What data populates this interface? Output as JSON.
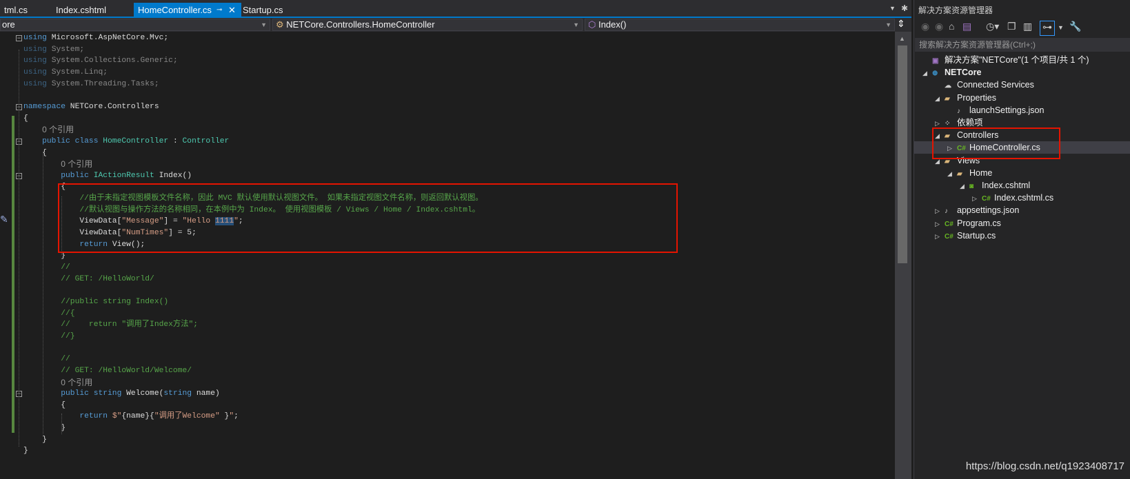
{
  "tabs": [
    {
      "label": "tml.cs",
      "active": false
    },
    {
      "label": "Index.cshtml",
      "active": false
    },
    {
      "label": "HomeController.cs",
      "active": true
    },
    {
      "label": "Startup.cs",
      "active": false
    }
  ],
  "tab_pin_icon": "pin-icon",
  "tab_close_icon": "close-icon",
  "nav": {
    "project": "ore",
    "type": "NETCore.Controllers.HomeController",
    "member": "Index()"
  },
  "code": [
    [
      [
        "using ",
        "kw"
      ],
      [
        "Microsoft.AspNetCore.Mvc;",
        "pl"
      ]
    ],
    [
      [
        "using ",
        "kw dim"
      ],
      [
        "System;",
        "pl dim"
      ]
    ],
    [
      [
        "using ",
        "kw dim"
      ],
      [
        "System.Collections.Generic;",
        "pl dim"
      ]
    ],
    [
      [
        "using ",
        "kw dim"
      ],
      [
        "System.Linq;",
        "pl dim"
      ]
    ],
    [
      [
        "using ",
        "kw dim"
      ],
      [
        "System.Threading.Tasks;",
        "pl dim"
      ]
    ],
    [],
    [
      [
        "namespace ",
        "kw"
      ],
      [
        "NETCore.Controllers",
        "pl"
      ]
    ],
    [
      [
        "{",
        "pl"
      ]
    ],
    [
      [
        "    ",
        "pl"
      ],
      [
        "0 个引用",
        "lens"
      ]
    ],
    [
      [
        "    public class ",
        "kw"
      ],
      [
        "HomeController",
        "ty"
      ],
      [
        " : ",
        "pl"
      ],
      [
        "Controller",
        "ty"
      ]
    ],
    [
      [
        "    {",
        "pl"
      ]
    ],
    [
      [
        "        ",
        "pl"
      ],
      [
        "0 个引用",
        "lens"
      ]
    ],
    [
      [
        "        public ",
        "kw"
      ],
      [
        "IActionResult ",
        "ty"
      ],
      [
        "Index()",
        "pl"
      ]
    ],
    [
      [
        "        {",
        "pl"
      ]
    ],
    [
      [
        "            //由于未指定视图模板文件名称，因此 MVC 默认使用默认视图文件。 如果未指定视图文件名称，则返回默认视图。",
        "cm"
      ]
    ],
    [
      [
        "            //默认视图与操作方法的名称相同，在本例中为 Index。 使用视图模板 / Views / Home / Index.cshtml。",
        "cm"
      ]
    ],
    [
      [
        "            ViewData[",
        "pl"
      ],
      [
        "\"Message\"",
        "st"
      ],
      [
        "] = ",
        "pl"
      ],
      [
        "\"Hello ",
        "st"
      ],
      [
        "1111",
        "st sel"
      ],
      [
        "\"",
        "st"
      ],
      [
        ";",
        "pl"
      ]
    ],
    [
      [
        "            ViewData[",
        "pl"
      ],
      [
        "\"NumTimes\"",
        "st"
      ],
      [
        "] = 5;",
        "pl"
      ]
    ],
    [
      [
        "            return ",
        "kw"
      ],
      [
        "View();",
        "pl"
      ]
    ],
    [
      [
        "        }",
        "pl"
      ]
    ],
    [
      [
        "        //",
        "cm"
      ]
    ],
    [
      [
        "        // GET: /HelloWorld/",
        "cm"
      ]
    ],
    [],
    [
      [
        "        //public string Index()",
        "cm"
      ]
    ],
    [
      [
        "        //{",
        "cm"
      ]
    ],
    [
      [
        "        //    return \"调用了Index方法\";",
        "cm"
      ]
    ],
    [
      [
        "        //}",
        "cm"
      ]
    ],
    [],
    [
      [
        "        //",
        "cm"
      ]
    ],
    [
      [
        "        // GET: /HelloWorld/Welcome/",
        "cm"
      ]
    ],
    [
      [
        "        ",
        "pl"
      ],
      [
        "0 个引用",
        "lens"
      ]
    ],
    [
      [
        "        public string ",
        "kw"
      ],
      [
        "Welcome(",
        "pl"
      ],
      [
        "string ",
        "kw"
      ],
      [
        "name)",
        "pl"
      ]
    ],
    [
      [
        "        {",
        "pl"
      ]
    ],
    [
      [
        "            return ",
        "kw"
      ],
      [
        "$\"",
        "st"
      ],
      [
        "{name}{",
        "pl"
      ],
      [
        "\"调用了Welcome\"",
        "st"
      ],
      [
        " }",
        "pl"
      ],
      [
        "\"",
        "st"
      ],
      [
        ";",
        "pl"
      ]
    ],
    [
      [
        "        }",
        "pl"
      ]
    ],
    [
      [
        "    }",
        "pl"
      ]
    ],
    [
      [
        "}",
        "pl"
      ]
    ]
  ],
  "panel": {
    "title": "解决方案资源管理器",
    "search_placeholder": "搜索解决方案资源管理器(Ctrl+;)",
    "tree": [
      {
        "label": "解决方案\"NETCore\"(1 个项目/共 1 个)",
        "icon": "solution-icon",
        "glyph": "▣",
        "color": "#a074c4",
        "level": 0,
        "exp": ""
      },
      {
        "label": "NETCore",
        "icon": "web-project-icon",
        "glyph": "⊕",
        "color": "#3c9ad6",
        "level": 0,
        "exp": "◢",
        "bold": true
      },
      {
        "label": "Connected Services",
        "icon": "connected-services-icon",
        "glyph": "☁",
        "color": "#ccc",
        "level": 1,
        "exp": ""
      },
      {
        "label": "Properties",
        "icon": "properties-folder-icon",
        "glyph": "▰",
        "color": "#dcb67a",
        "level": 1,
        "exp": "◢"
      },
      {
        "label": "launchSettings.json",
        "icon": "json-file-icon",
        "glyph": "♪",
        "color": "#ccc",
        "level": 2,
        "exp": ""
      },
      {
        "label": "依赖项",
        "icon": "dependencies-icon",
        "glyph": "⁘",
        "color": "#ccc",
        "level": 1,
        "exp": "▷"
      },
      {
        "label": "Controllers",
        "icon": "folder-icon",
        "glyph": "▰",
        "color": "#dcb67a",
        "level": 1,
        "exp": "◢"
      },
      {
        "label": "HomeController.cs",
        "icon": "csharp-file-icon",
        "glyph": "C#",
        "color": "#68b723",
        "level": 2,
        "exp": "▷",
        "selected": true
      },
      {
        "label": "Views",
        "icon": "folder-icon",
        "glyph": "▰",
        "color": "#dcb67a",
        "level": 1,
        "exp": "◢"
      },
      {
        "label": "Home",
        "icon": "folder-icon",
        "glyph": "▰",
        "color": "#dcb67a",
        "level": 2,
        "exp": "◢"
      },
      {
        "label": "Index.cshtml",
        "icon": "razor-file-icon",
        "glyph": "◙",
        "color": "#68b723",
        "level": 3,
        "exp": "◢"
      },
      {
        "label": "Index.cshtml.cs",
        "icon": "csharp-file-icon",
        "glyph": "C#",
        "color": "#68b723",
        "level": 4,
        "exp": "▷"
      },
      {
        "label": "appsettings.json",
        "icon": "json-file-icon",
        "glyph": "♪",
        "color": "#ccc",
        "level": 1,
        "exp": "▷"
      },
      {
        "label": "Program.cs",
        "icon": "csharp-file-icon",
        "glyph": "C#",
        "color": "#68b723",
        "level": 1,
        "exp": "▷"
      },
      {
        "label": "Startup.cs",
        "icon": "csharp-file-icon",
        "glyph": "C#",
        "color": "#68b723",
        "level": 1,
        "exp": "▷"
      }
    ]
  },
  "watermark": "https://blog.csdn.net/q1923408717",
  "colors": {
    "accent": "#007acc",
    "highlight_box": "#e51400",
    "keyword": "#569cd6",
    "type": "#4ec9b0",
    "string": "#d69d85",
    "comment": "#57a64a"
  }
}
